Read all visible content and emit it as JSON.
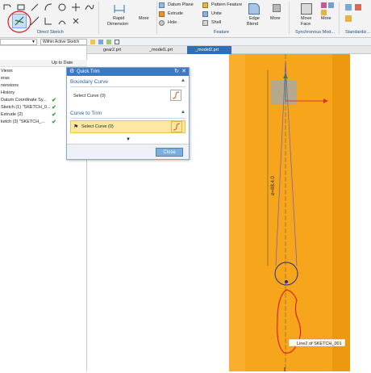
{
  "ribbon": {
    "rapid_dimension": "Rapid\nDimension",
    "rapid_line1": "Rapid",
    "rapid_line2": "Dimension",
    "more_left": "More",
    "datum_plane": "Datum Plane",
    "extrude": "Extrude",
    "hole": "Hole",
    "pattern_feature": "Pattern Feature",
    "unite": "Unite",
    "shell": "Shell",
    "edge_blend_line1": "Edge",
    "edge_blend_line2": "Blend",
    "more_right": "More",
    "move_face_line1": "Move",
    "move_face_line2": "Face",
    "more_sync": "More",
    "group_direct_sketch": "Direct Sketch",
    "group_feature": "Feature",
    "group_sync": "Synchronous Mod...",
    "group_standard": "Standardiz..."
  },
  "navigator": {
    "filter_left": "",
    "filter_right": "Within Active Sketch",
    "column_updated": "Up to Date",
    "items": [
      {
        "label": "Views",
        "check": false
      },
      {
        "label": "eras",
        "check": false
      },
      {
        "label": "nensions",
        "check": false
      },
      {
        "label": "History",
        "check": false
      },
      {
        "label": "Datum Coordinate Sy...",
        "check": true
      },
      {
        "label": "Sketch (1) \"SKETCH_0...",
        "check": true
      },
      {
        "label": "Extrude (2)",
        "check": true
      },
      {
        "label": "ketch (3) \"SKETCH_...",
        "check": true
      }
    ]
  },
  "tabs": [
    {
      "label": "gear2.prt"
    },
    {
      "label": "_model1.prt"
    },
    {
      "label": "_model2.prt"
    }
  ],
  "dialog": {
    "title": "Quick Trim",
    "boundary_section": "Boundary Curve",
    "boundary_select": "Select Curve (0)",
    "trim_section": "Curve to Trim",
    "trim_select": "Select Curve (0)",
    "close": "Close"
  },
  "viewport": {
    "tooltip": "Line2 of SKETCH_001",
    "dimension": "ø=88.4.0"
  },
  "colors": {
    "part": "#f7a51b",
    "dialog_title": "#3e78bf",
    "highlight": "#fde8a3",
    "annotation": "#e0141e"
  }
}
